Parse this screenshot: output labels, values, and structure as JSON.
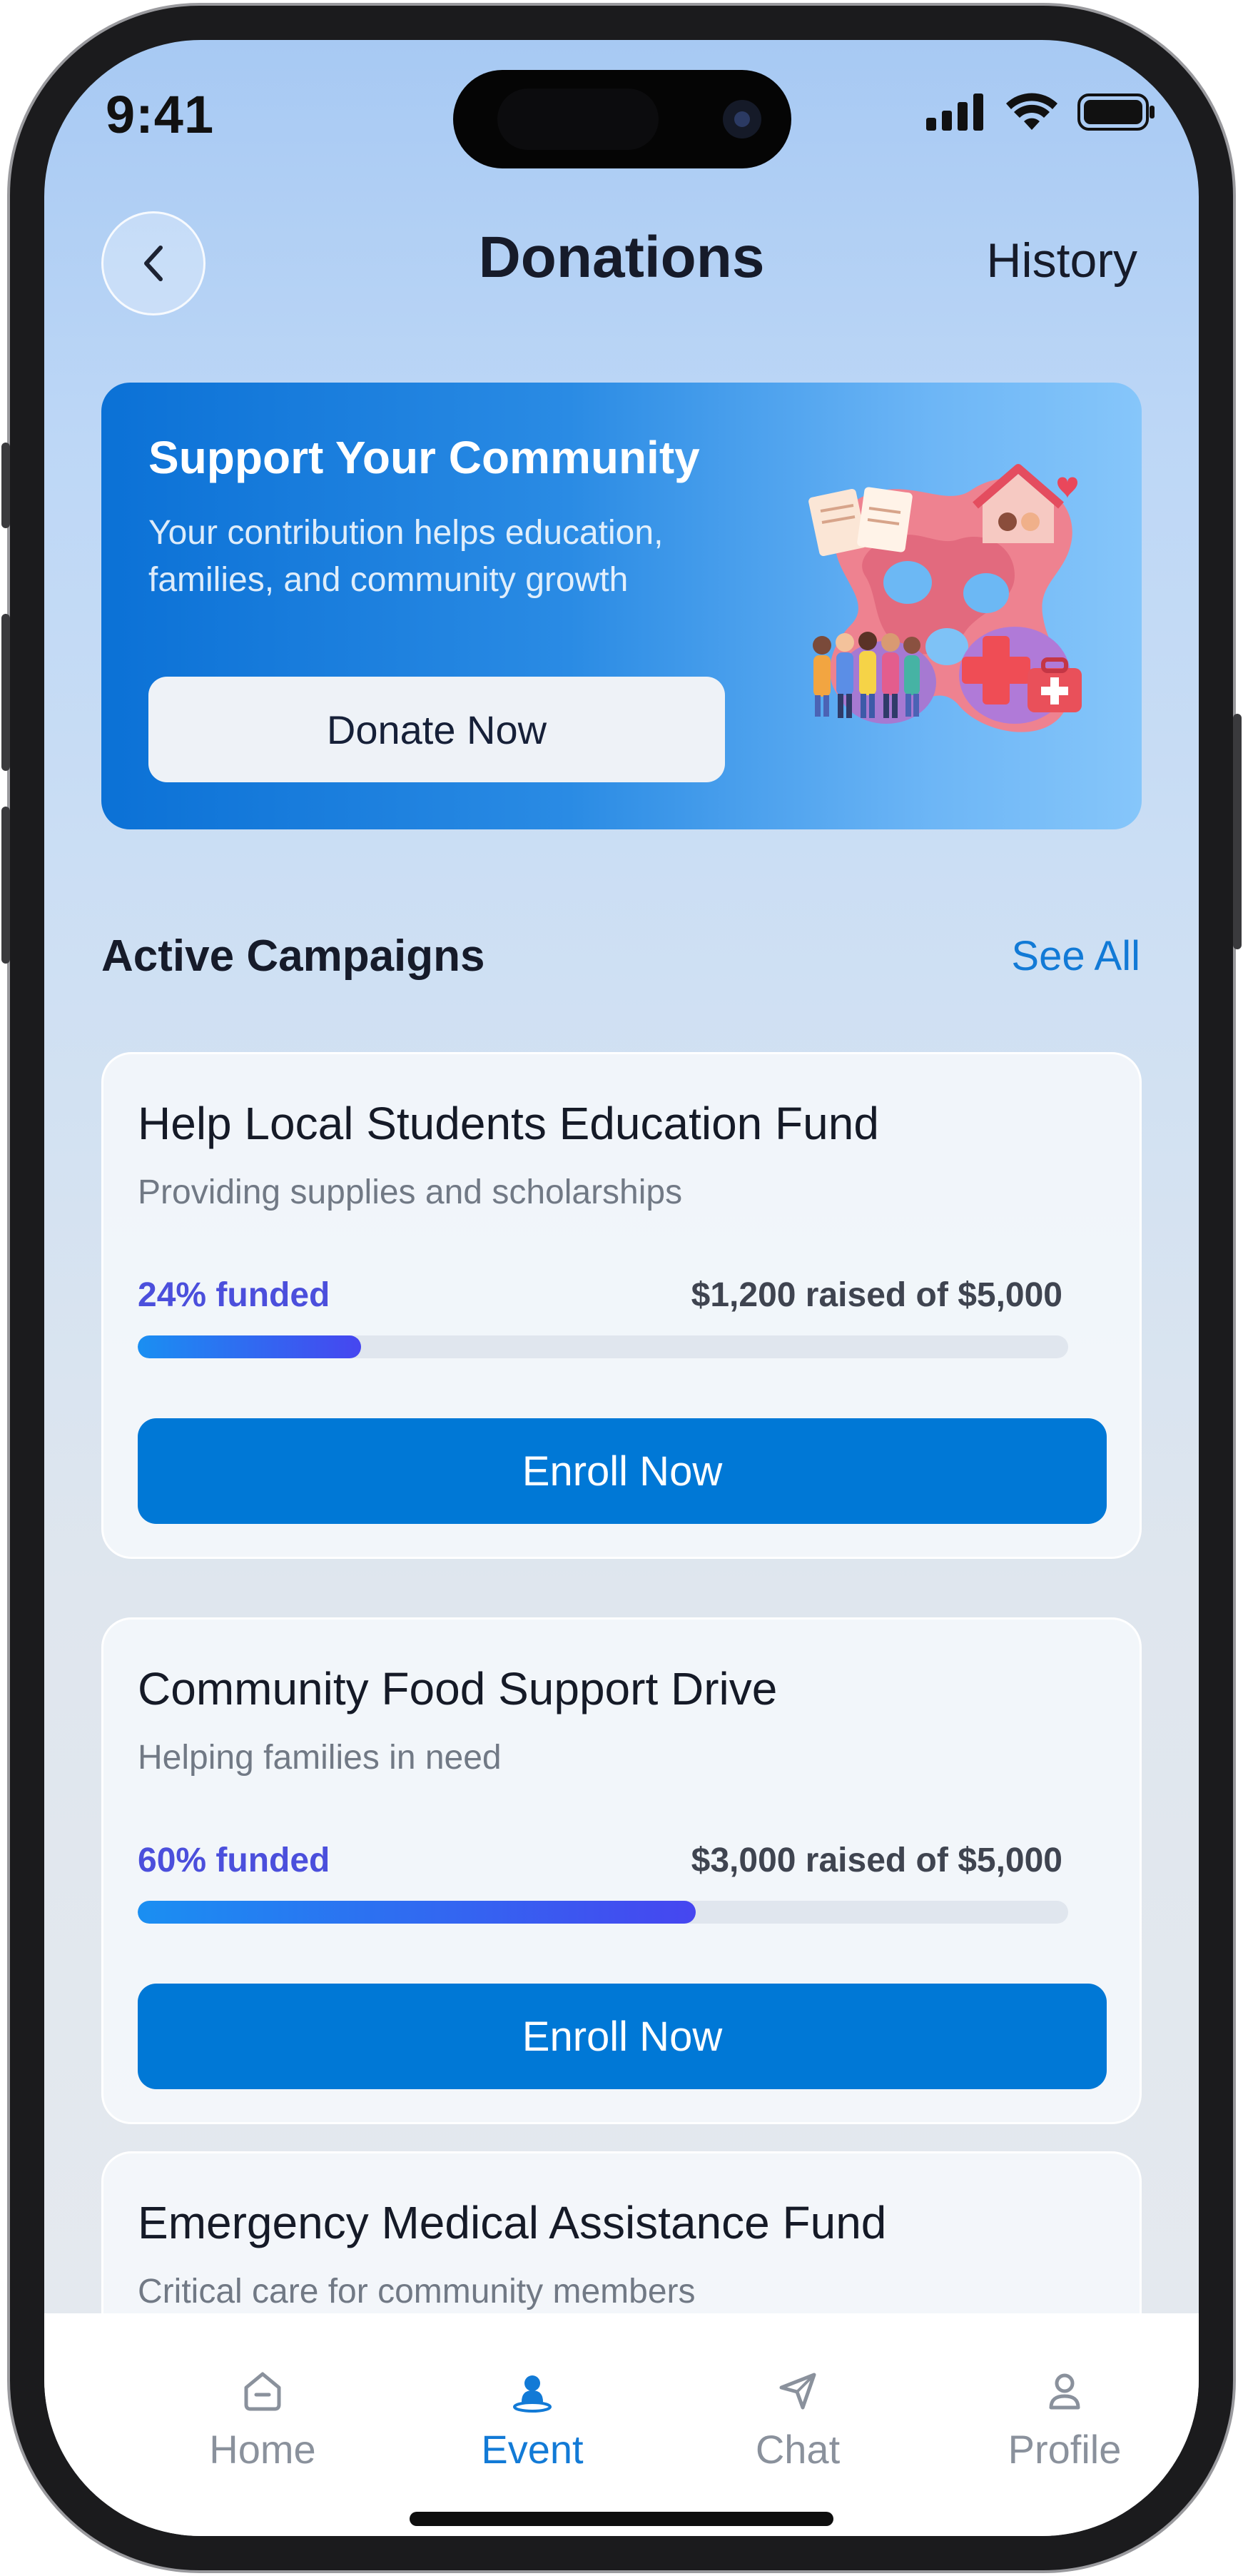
{
  "status_bar": {
    "time": "9:41"
  },
  "header": {
    "title": "Donations",
    "history_label": "History"
  },
  "hero": {
    "title": "Support Your Community",
    "subtitle": "Your contribution helps education, families, and community growth",
    "button_label": "Donate Now"
  },
  "campaigns_section": {
    "title": "Active Campaigns",
    "see_all_label": "See All"
  },
  "campaigns": [
    {
      "title": "Help Local Students Education Fund",
      "subtitle": "Providing supplies and scholarships",
      "funded_label": "24% funded",
      "raised_label": "$1,200 raised of $5,000",
      "progress": 0.24,
      "button_label": "Enroll Now"
    },
    {
      "title": "Community Food Support Drive",
      "subtitle": "Helping families in need",
      "funded_label": "60% funded",
      "raised_label": "$3,000 raised of $5,000",
      "progress": 0.6,
      "button_label": "Enroll Now"
    },
    {
      "title": "Emergency Medical Assistance Fund",
      "subtitle": "Critical care for community members"
    }
  ],
  "tabbar": {
    "items": [
      {
        "label": "Home",
        "icon": "home-icon",
        "active": false
      },
      {
        "label": "Event",
        "icon": "event-person-icon",
        "active": true
      },
      {
        "label": "Chat",
        "icon": "send-icon",
        "active": false
      },
      {
        "label": "Profile",
        "icon": "profile-icon",
        "active": false
      }
    ]
  },
  "colors": {
    "accent": "#127ad6",
    "primary_button": "#0078d6",
    "funded_text": "#4b4fdc",
    "progress_start": "#1a8ff2",
    "progress_end": "#4646f0"
  }
}
